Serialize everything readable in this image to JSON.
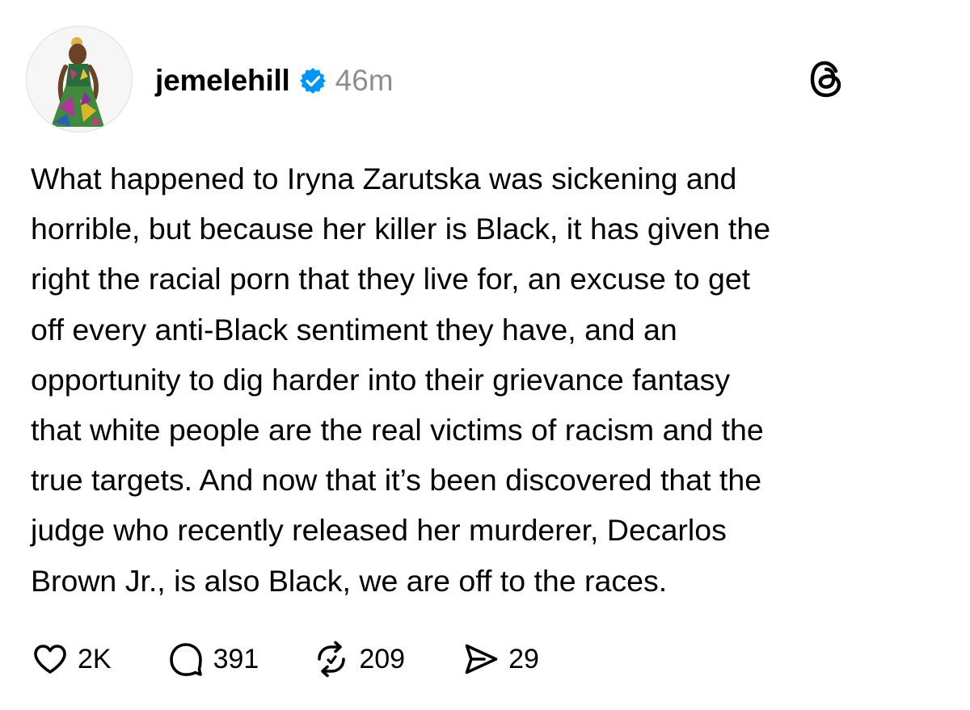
{
  "post": {
    "author": {
      "username": "jemelehill",
      "verified": true,
      "avatar_icon": "profile-photo"
    },
    "time": "46m",
    "app_icon": "threads-logo-icon",
    "text": "What happened to Iryna Zarutska was sickening and\nhorrible, but because her killer is Black, it has given the\nright the racial porn that they live for, an excuse to get\noff every anti-Black sentiment they have, and an\nopportunity to dig harder into their grievance fantasy\nthat white people are the real victims of racism and the\ntrue targets. And now that it’s been discovered that the\njudge who recently released her murderer, Decarlos\nBrown Jr., is also Black, we are off to the races.",
    "actions": {
      "likes": "2K",
      "replies": "391",
      "reposts": "209",
      "shares": "29"
    }
  },
  "colors": {
    "verified_badge": "#0095f6",
    "time_gray": "#8e8e8e",
    "text": "#000000"
  }
}
